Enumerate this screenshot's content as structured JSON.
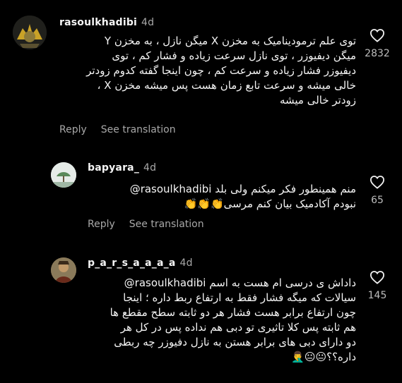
{
  "comments": [
    {
      "username": "rasoulkhadibi",
      "age": "4d",
      "lines": [
        "توی علم ترمودینامیک به مخزن X میگن نازل ، به مخزن Y",
        "میگن دیفیوزر ، توی نازل سرعت زیاده و فشار کم ، توی",
        "دیفیوزر فشار زیاده و سرعت کم ، چون اینجا گفته کدوم زودتر",
        "خالی میشه و سرعت تابع زمان هست پس میشه مخزن X ،",
        "زودتر خالی میشه"
      ],
      "reply_label": "Reply",
      "translate_label": "See translation",
      "likes": "2832"
    },
    {
      "username": "bapyara_",
      "age": "4d",
      "mention": "@rasoulkhadibi",
      "lines": [
        "منم همینطور فکر میکنم ولی بلد",
        "نبودم آکادمیک بیان کنم مرسی👏👏👏"
      ],
      "reply_label": "Reply",
      "translate_label": "See translation",
      "likes": "65"
    },
    {
      "username": "p_a_r_s_a_a_a_a",
      "age": "4d",
      "mention": "@rasoulkhadibi",
      "lines": [
        "داداش ی درسی ام هست به اسم",
        "سیالات که میگه فشار فقط به ارتفاع ربط داره ؛ اینجا",
        "چون ارتفاع برابر هست فشار هر دو ثابته سطح مقطع ها",
        "هم ثابته پس کلا تاثیری تو دبی هم نداده پس در کل هر",
        "دو دارای دبی های برابر هستن به نازل دفیوزر چه ربطی",
        "داره؟؟😐😐🤦‍♂️"
      ],
      "likes": "145"
    }
  ]
}
